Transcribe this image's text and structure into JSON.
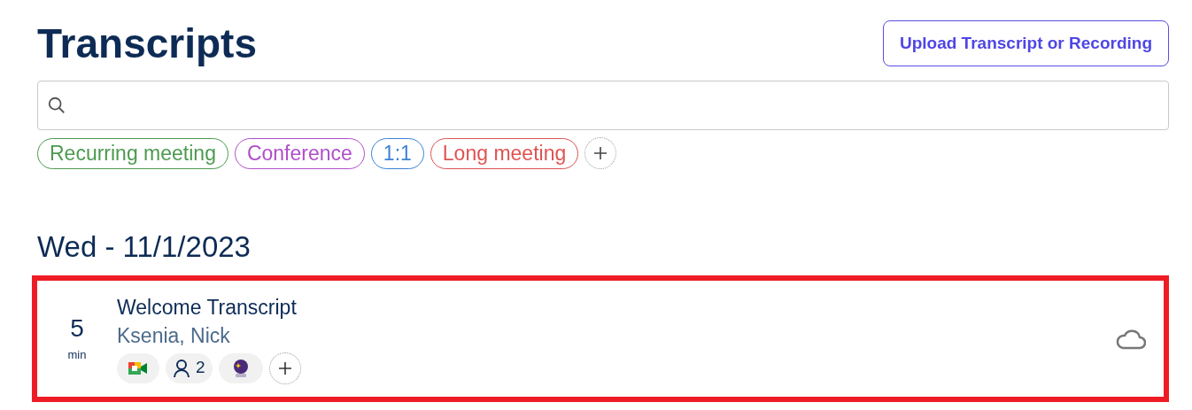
{
  "title": "Transcripts",
  "upload_button": "Upload Transcript or Recording",
  "tags": [
    {
      "label": "Recurring meeting",
      "color": "#4c9a4f"
    },
    {
      "label": "Conference",
      "color": "#b04fc8"
    },
    {
      "label": "1:1",
      "color": "#3b82d6"
    },
    {
      "label": "Long meeting",
      "color": "#e05252"
    }
  ],
  "groups": [
    {
      "date": "Wed - 11/1/2023",
      "items": [
        {
          "duration": "5",
          "unit": "min",
          "title": "Welcome Transcript",
          "participants": "Ksenia, Nick",
          "highlighted": true,
          "attendee_count": "2"
        }
      ]
    }
  ]
}
